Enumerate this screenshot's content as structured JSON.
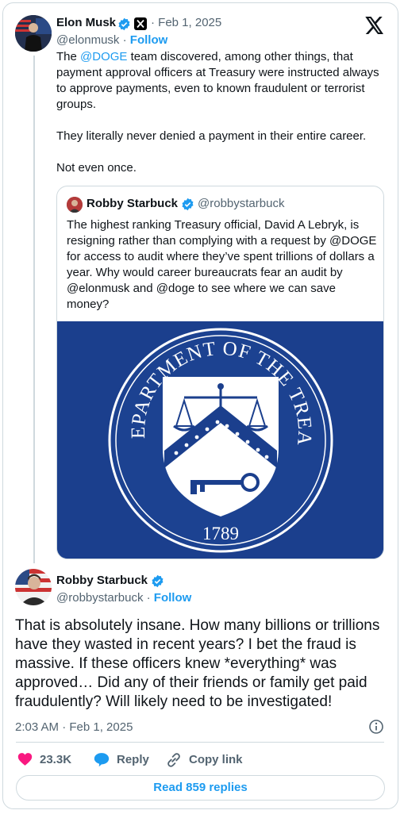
{
  "colors": {
    "accent": "#1d9bf0",
    "verified": "#1d9bf0",
    "like": "#f91880",
    "treasury_bg": "#1a3f8c"
  },
  "tweet": {
    "author_name": "Elon Musk",
    "handle": "@elonmusk",
    "date": "· Feb 1, 2025",
    "follow_label": "Follow",
    "text_prefix": "The ",
    "mention": "@DOGE",
    "text_rest": " team discovered, among other things, that payment approval officers at Treasury were instructed always to approve payments, even to known fraudulent or terrorist groups.",
    "paragraph2": "They literally never denied a payment in their entire career.",
    "paragraph3": "Not even once."
  },
  "quote": {
    "author_name": "Robby Starbuck",
    "handle": "@robbystarbuck",
    "text": "The highest ranking Treasury official, David A Lebryk, is resigning rather than complying with a request by @DOGE for access to audit where they’ve spent trillions of dollars a year. Why would career bureaucrats fear an audit by @elonmusk and @doge to see where we can save money?",
    "seal_text": "THE DEPARTMENT OF THE TREASURY",
    "seal_year": "1789"
  },
  "reply": {
    "author_name": "Robby Starbuck",
    "handle": "@robbystarbuck",
    "follow_label": "Follow",
    "text": "That is absolutely insane. How many billions or trillions have they wasted in recent years? I bet the fraud is massive. If these officers knew *everything* was approved… Did any of their friends or family get paid fraudulently? Will likely need to be investigated!",
    "timestamp": "2:03 AM · Feb 1, 2025"
  },
  "actions": {
    "likes": "23.3K",
    "reply_label": "Reply",
    "copy_label": "Copy link",
    "read_replies": "Read 859 replies"
  }
}
